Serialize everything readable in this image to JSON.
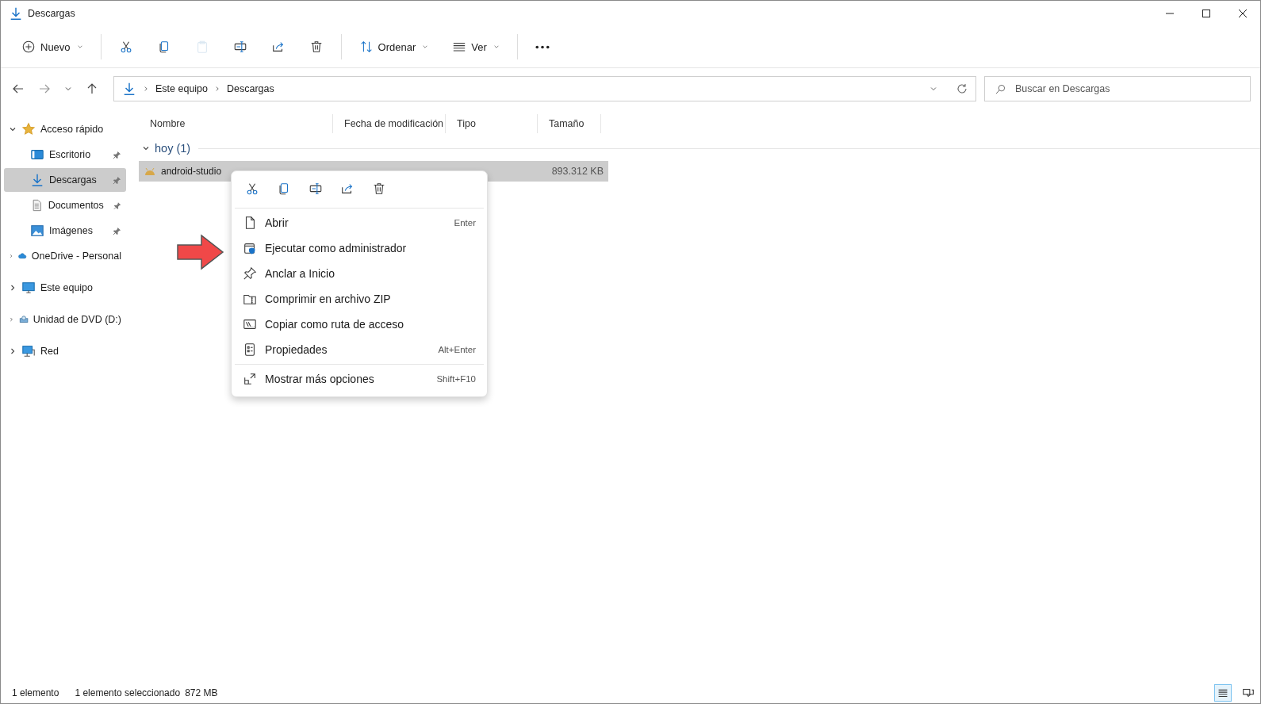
{
  "window": {
    "title": "Descargas"
  },
  "toolbar": [
    {
      "kind": "new",
      "label": "Nuevo",
      "disabled": false
    },
    {
      "kind": "cut",
      "disabled": false
    },
    {
      "kind": "copy",
      "disabled": false
    },
    {
      "kind": "paste",
      "disabled": true
    },
    {
      "kind": "rename",
      "disabled": false
    },
    {
      "kind": "share",
      "disabled": false
    },
    {
      "kind": "delete",
      "disabled": false
    },
    {
      "kind": "sort",
      "label": "Ordenar",
      "disabled": false
    },
    {
      "kind": "view",
      "label": "Ver",
      "disabled": false
    },
    {
      "kind": "more",
      "disabled": false
    }
  ],
  "address": {
    "path": [
      "Este equipo",
      "Descargas"
    ]
  },
  "search": {
    "placeholder": "Buscar en Descargas"
  },
  "sidebar": {
    "items": [
      {
        "kind": "star",
        "label": "Acceso rápido",
        "expanded": true,
        "selected": false,
        "children": [
          {
            "kind": "desktop",
            "label": "Escritorio",
            "pinned": true,
            "selected": false
          },
          {
            "kind": "download",
            "label": "Descargas",
            "pinned": true,
            "selected": true
          },
          {
            "kind": "document",
            "label": "Documentos",
            "pinned": true,
            "selected": false
          },
          {
            "kind": "image",
            "label": "Imágenes",
            "pinned": true,
            "selected": false
          }
        ]
      },
      {
        "kind": "cloud",
        "label": "OneDrive - Personal",
        "expanded": false,
        "selected": false
      },
      {
        "kind": "monitor",
        "label": "Este equipo",
        "expanded": false,
        "selected": false
      },
      {
        "kind": "dvd",
        "label": "Unidad de DVD (D:)",
        "expanded": false,
        "selected": false
      },
      {
        "kind": "network",
        "label": "Red",
        "expanded": false,
        "selected": false
      }
    ]
  },
  "table": {
    "columns": [
      "Nombre",
      "Fecha de modificación",
      "Tipo",
      "Tamaño"
    ],
    "group": {
      "label": "hoy (1)",
      "expanded": true
    },
    "rows": [
      {
        "name": "android-studio",
        "size": "893.312 KB",
        "selected": true
      }
    ]
  },
  "context_menu": {
    "quick_actions": [
      {
        "kind": "cut"
      },
      {
        "kind": "copy"
      },
      {
        "kind": "rename"
      },
      {
        "kind": "share"
      },
      {
        "kind": "delete"
      }
    ],
    "items": [
      {
        "kind": "open",
        "label": "Abrir",
        "shortcut": "Enter"
      },
      {
        "kind": "admin",
        "label": "Ejecutar como administrador"
      },
      {
        "kind": "pin",
        "label": "Anclar a Inicio"
      },
      {
        "kind": "zip",
        "label": "Comprimir en archivo ZIP"
      },
      {
        "kind": "path",
        "label": "Copiar como ruta de acceso"
      },
      {
        "kind": "properties",
        "label": "Propiedades",
        "shortcut": "Alt+Enter"
      }
    ],
    "footer_item": {
      "kind": "expand",
      "label": "Mostrar más opciones",
      "shortcut": "Shift+F10"
    }
  },
  "status_bar": {
    "item_count": "1 elemento",
    "selection": "1 elemento seleccionado",
    "selection_size": "872 MB"
  },
  "view_buttons": [
    {
      "kind": "details",
      "selected": true
    },
    {
      "kind": "tiles",
      "selected": false
    }
  ]
}
